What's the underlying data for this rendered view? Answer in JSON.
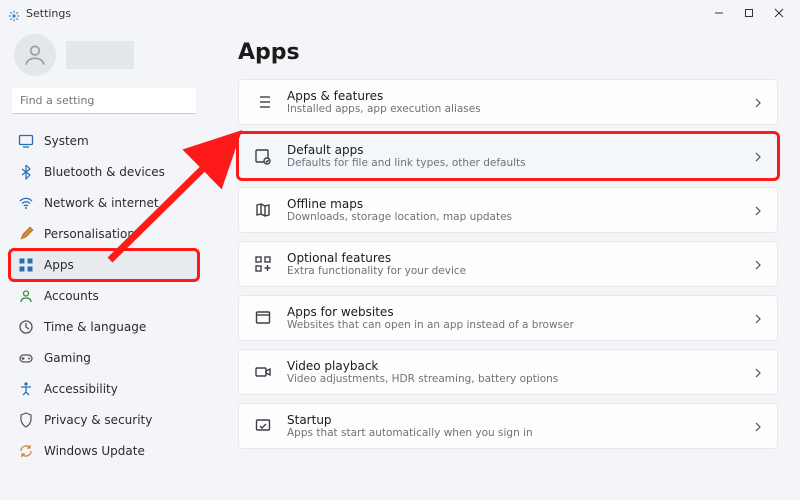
{
  "titlebar": {
    "title": "Settings"
  },
  "search": {
    "placeholder": "Find a setting"
  },
  "sidebar": {
    "items": [
      {
        "label": "System"
      },
      {
        "label": "Bluetooth & devices"
      },
      {
        "label": "Network & internet"
      },
      {
        "label": "Personalisation"
      },
      {
        "label": "Apps"
      },
      {
        "label": "Accounts"
      },
      {
        "label": "Time & language"
      },
      {
        "label": "Gaming"
      },
      {
        "label": "Accessibility"
      },
      {
        "label": "Privacy & security"
      },
      {
        "label": "Windows Update"
      }
    ]
  },
  "page": {
    "title": "Apps"
  },
  "cards": [
    {
      "title": "Apps & features",
      "sub": "Installed apps, app execution aliases"
    },
    {
      "title": "Default apps",
      "sub": "Defaults for file and link types, other defaults"
    },
    {
      "title": "Offline maps",
      "sub": "Downloads, storage location, map updates"
    },
    {
      "title": "Optional features",
      "sub": "Extra functionality for your device"
    },
    {
      "title": "Apps for websites",
      "sub": "Websites that can open in an app instead of a browser"
    },
    {
      "title": "Video playback",
      "sub": "Video adjustments, HDR streaming, battery options"
    },
    {
      "title": "Startup",
      "sub": "Apps that start automatically when you sign in"
    }
  ],
  "colors": {
    "highlight": "#ff1a1a"
  }
}
